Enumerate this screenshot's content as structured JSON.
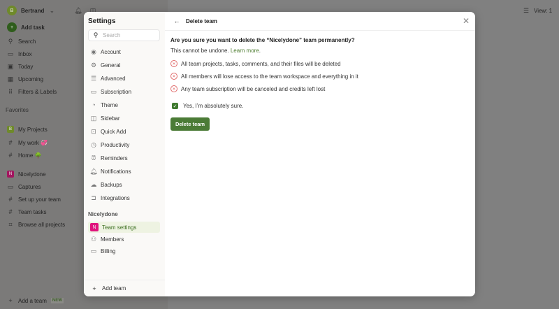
{
  "sidebar": {
    "user": "Bertrand",
    "user_initial": "B",
    "add_task": "Add task",
    "nav": [
      "Search",
      "Inbox",
      "Today",
      "Upcoming",
      "Filters & Labels"
    ],
    "favorites_label": "Favorites",
    "favorites": [
      {
        "label": "My Projects",
        "badge": "B"
      },
      {
        "label": "My work 💞"
      },
      {
        "label": "Home 🌳"
      }
    ],
    "team": {
      "label": "Nicelydone",
      "badge": "N"
    },
    "team_items": [
      "Captures",
      "Set up your team",
      "Team tasks",
      "Browse all projects"
    ],
    "add_team": "Add a team",
    "new_badge": "NEW"
  },
  "top": {
    "view": "View: 1"
  },
  "settings": {
    "title": "Settings",
    "search_placeholder": "Search",
    "items": [
      "Account",
      "General",
      "Advanced",
      "Subscription",
      "Theme",
      "Sidebar",
      "Quick Add",
      "Productivity",
      "Reminders",
      "Notifications",
      "Backups",
      "Integrations"
    ],
    "team_section": "Nicelydone",
    "team_badge": "N",
    "team_items": [
      "Team settings",
      "Members",
      "Billing"
    ],
    "add_team": "Add team"
  },
  "dialog": {
    "title": "Delete team",
    "question": "Are you sure you want to delete the “Nicelydone” team permanently?",
    "undone": "This cannot be undone.",
    "learn_more": "Learn more",
    "warnings": [
      "All team projects, tasks, comments, and their files will be deleted",
      "All members will lose access to the team workspace and everything in it",
      "Any team subscription will be canceled and credits left lost"
    ],
    "confirm": "Yes, I’m absolutely sure.",
    "delete_button": "Delete team"
  }
}
